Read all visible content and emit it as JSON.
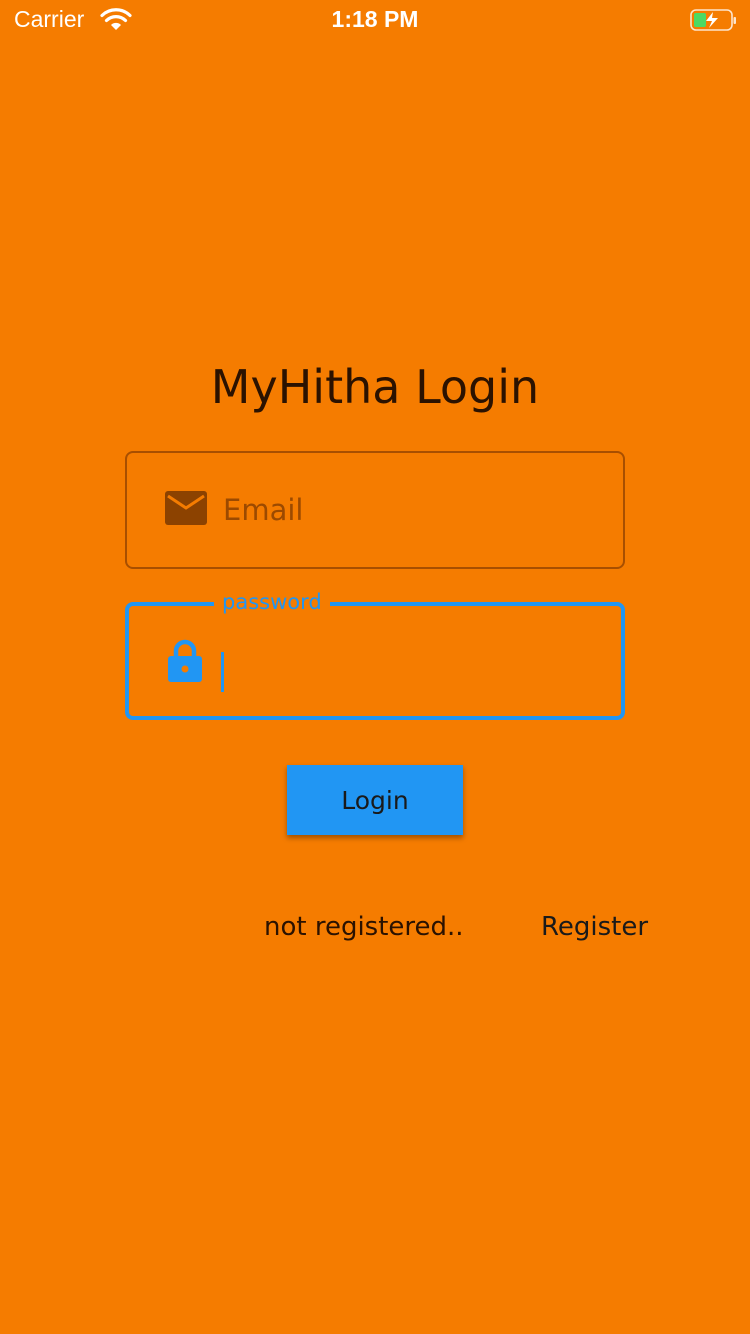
{
  "status_bar": {
    "carrier": "Carrier",
    "time": "1:18 PM",
    "wifi_icon": "wifi-icon",
    "battery_icon": "battery-charging-icon"
  },
  "login": {
    "title": "MyHitha Login",
    "email_placeholder": "Email",
    "email_icon": "mail-icon",
    "password_label": "password",
    "password_icon": "lock-icon",
    "button_label": "Login"
  },
  "footer": {
    "not_registered_text": "not registered..",
    "register_label": "Register"
  },
  "colors": {
    "background": "#F57C00",
    "accent": "#2196F3",
    "email_border": "#A84F00",
    "title_text": "#2B1200"
  }
}
